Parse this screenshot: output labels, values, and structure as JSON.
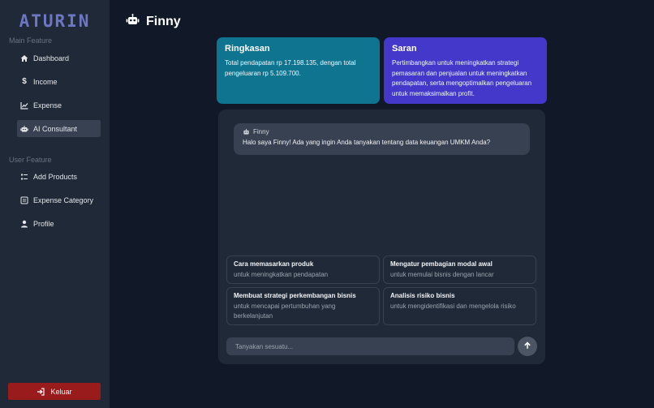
{
  "sidebar": {
    "brand": "ATURIN",
    "main_section_label": "Main Feature",
    "main_items": [
      {
        "label": "Dashboard",
        "icon": "home-icon"
      },
      {
        "label": "Income",
        "icon": "dollar-icon"
      },
      {
        "label": "Expense",
        "icon": "line-chart-icon"
      },
      {
        "label": "AI Consultant",
        "icon": "robot-icon",
        "active": true
      }
    ],
    "user_section_label": "User Feature",
    "user_items": [
      {
        "label": "Add Products",
        "icon": "list-icon"
      },
      {
        "label": "Expense Category",
        "icon": "list-box-icon"
      },
      {
        "label": "Profile",
        "icon": "user-icon"
      }
    ],
    "logout_label": "Keluar"
  },
  "header": {
    "title": "Finny",
    "icon": "robot-icon"
  },
  "cards": {
    "summary": {
      "title": "Ringkasan",
      "text": "Total pendapatan rp 17.198.135, dengan total pengeluaran rp 5.109.700.",
      "color": "#0e7490"
    },
    "advice": {
      "title": "Saran",
      "text": "Pertimbangkan untuk meningkatkan strategi pemasaran dan penjualan untuk meningkatkan pendapatan, serta mengoptimalkan pengeluaran untuk memaksimalkan profit.",
      "color": "#4338ca"
    }
  },
  "chat": {
    "bot_name": "Finny",
    "greeting": "Halo saya Finny! Ada yang ingin Anda tanyakan tentang data keuangan UMKM Anda?",
    "suggestions": [
      {
        "title": "Cara memasarkan produk",
        "subtitle": "untuk meningkatkan pendapatan"
      },
      {
        "title": "Mengatur pembagian modal awal",
        "subtitle": "untuk memulai bisnis dengan lancar"
      },
      {
        "title": "Membuat strategi perkembangan bisnis",
        "subtitle": "untuk mencapai pertumbuhan yang berkelanjutan"
      },
      {
        "title": "Analisis risiko bisnis",
        "subtitle": "untuk mengidentifikasi dan mengelola risiko"
      }
    ],
    "input_placeholder": "Tanyakan sesuatu...",
    "input_value": ""
  }
}
